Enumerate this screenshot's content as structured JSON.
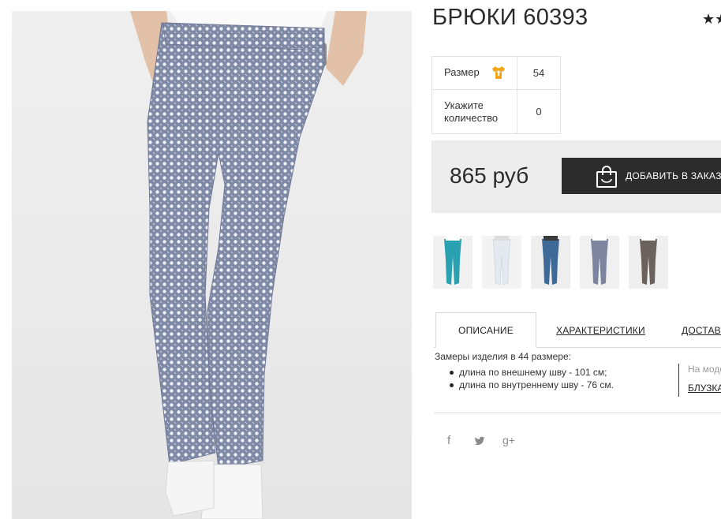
{
  "product": {
    "title": "БРЮКИ 60393",
    "rating_stars": "★★"
  },
  "options": {
    "size_label": "Размер",
    "size_value": "54",
    "size_icon": "tshirt-icon",
    "quantity_label_line1": "Укажите",
    "quantity_label_line2": "количество",
    "quantity_value": "0"
  },
  "purchase": {
    "price": "865 руб",
    "add_button_label": "ДОБАВИТЬ В ЗАКАЗ",
    "add_button_icon": "shopping-bag-icon"
  },
  "thumbnails": [
    {
      "name": "turquoise",
      "color": "#2aa1b0"
    },
    {
      "name": "white",
      "color": "#e9eef3"
    },
    {
      "name": "denim-blue",
      "color": "#3f6a98"
    },
    {
      "name": "grey-print",
      "color": "#7c84a0"
    },
    {
      "name": "brown-print",
      "color": "#6b625e"
    }
  ],
  "tabs": [
    {
      "label": "ОПИСАНИЕ",
      "active": true
    },
    {
      "label": "ХАРАКТЕРИСТИКИ",
      "active": false
    },
    {
      "label": "ДОСТАВКА",
      "active": false
    }
  ],
  "description": {
    "heading": "Замеры изделия в 44 размере:",
    "items": [
      "длина по внешнему шву - 101 см;",
      "длина по внутреннему шву - 76 см."
    ],
    "model_note": "На модели",
    "model_link": "БЛУЗКА"
  },
  "share": [
    {
      "icon": "facebook-icon",
      "glyph": "f"
    },
    {
      "icon": "twitter-icon",
      "glyph": "t"
    },
    {
      "icon": "google-plus-icon",
      "glyph": "g+"
    }
  ],
  "colors": {
    "accent_dark": "#2c2c2c",
    "icon_orange": "#f3a81b",
    "panel_gray": "#ededed"
  }
}
